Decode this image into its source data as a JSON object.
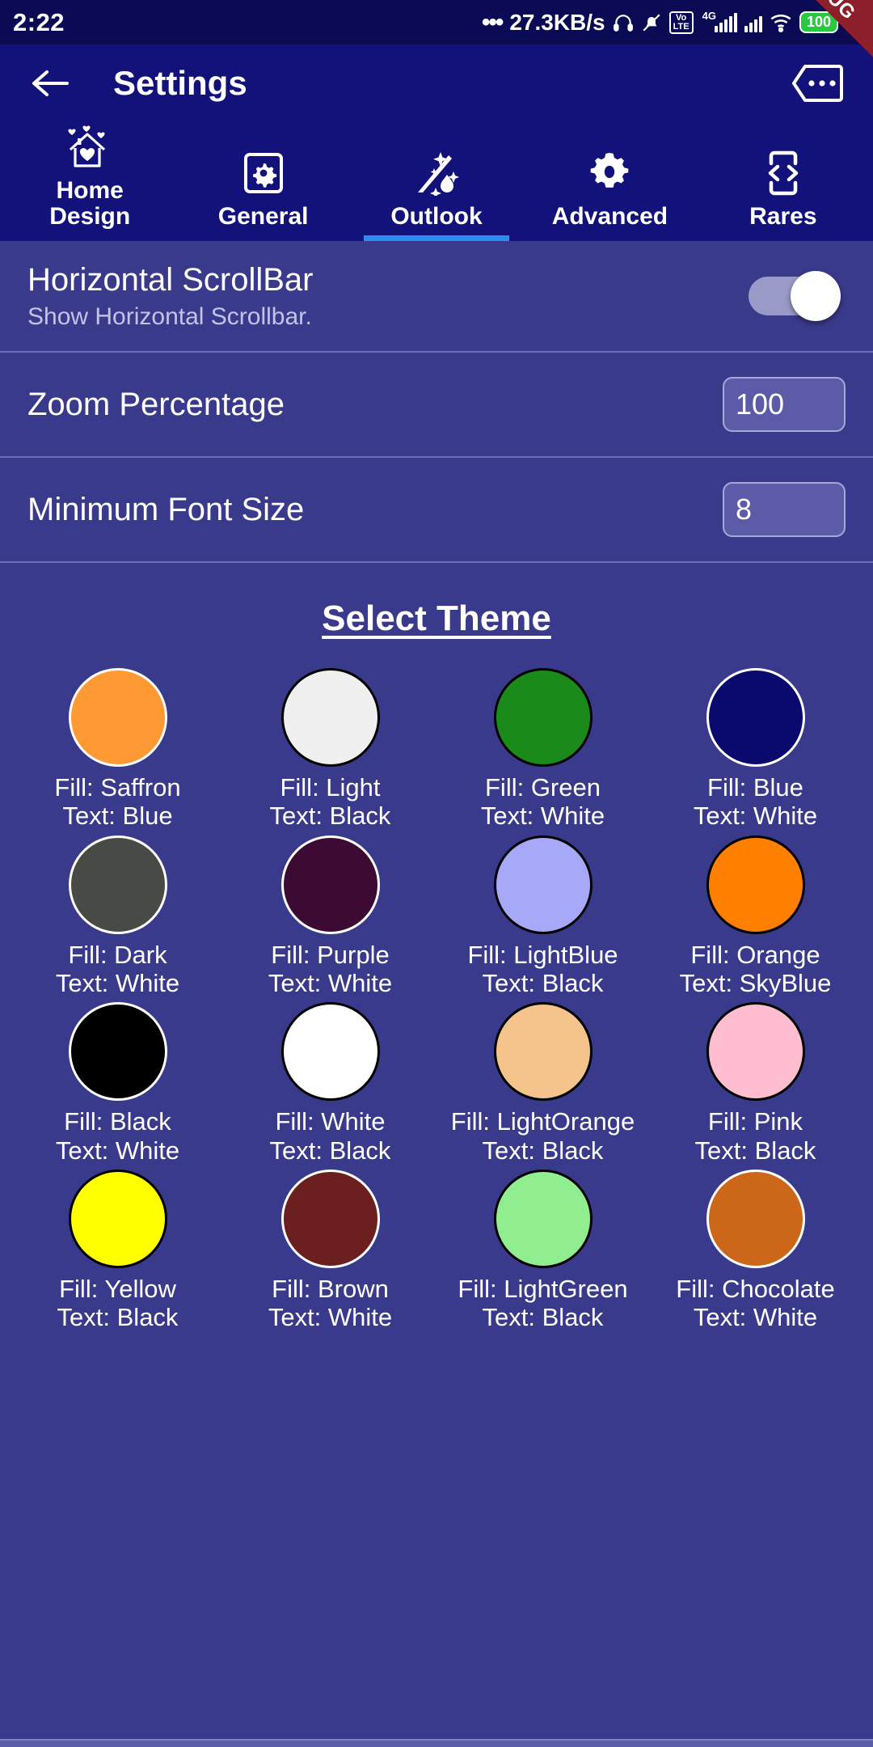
{
  "status_bar": {
    "time": "2:22",
    "dots": "•••",
    "network_speed": "27.3KB/s",
    "volte_top": "Vo",
    "volte_bottom": "LTE",
    "network_gen": "4G",
    "battery": "100",
    "icons": [
      "headset-icon",
      "bell-muted-icon",
      "volte-icon",
      "signal-bars-icon",
      "signal-bars-icon",
      "wifi-icon",
      "battery-icon",
      "charging-bolt-icon"
    ]
  },
  "debug_ribbon": {
    "label": "DEBUG"
  },
  "app_bar": {
    "back_icon": "back-arrow-icon",
    "title": "Settings",
    "overflow_icon": "overflow-menu-icon"
  },
  "tabs": {
    "active_index": 2,
    "items": [
      {
        "label": "Home\nDesign",
        "icon": "house-heart-icon"
      },
      {
        "label": "General",
        "icon": "gear-in-square-icon"
      },
      {
        "label": "Outlook",
        "icon": "moon-stars-wand-icon"
      },
      {
        "label": "Advanced",
        "icon": "gear-icon"
      },
      {
        "label": "Rares",
        "icon": "phone-code-icon"
      }
    ]
  },
  "settings": {
    "rows": [
      {
        "type": "switch",
        "title": "Horizontal ScrollBar",
        "subtitle": "Show Horizontal Scrollbar.",
        "value": "on"
      },
      {
        "type": "number",
        "title": "Zoom Percentage",
        "subtitle": "",
        "value": "100"
      },
      {
        "type": "number",
        "title": "Minimum Font Size",
        "subtitle": "",
        "value": "8"
      }
    ]
  },
  "theme_section": {
    "title": "Select Theme",
    "themes": [
      {
        "fill_label": "Fill: Saffron",
        "text_label": "Text: Blue",
        "fill": "#FF9933",
        "border": "#FFFFFF"
      },
      {
        "fill_label": "Fill: Light",
        "text_label": "Text: Black",
        "fill": "#F0F0F0",
        "border": "#000000"
      },
      {
        "fill_label": "Fill: Green",
        "text_label": "Text: White",
        "fill": "#1A8A1A",
        "border": "#000000"
      },
      {
        "fill_label": "Fill: Blue",
        "text_label": "Text: White",
        "fill": "#0A0A6E",
        "border": "#FFFFFF"
      },
      {
        "fill_label": "Fill: Dark",
        "text_label": "Text: White",
        "fill": "#474A45",
        "border": "#FFFFFF"
      },
      {
        "fill_label": "Fill: Purple",
        "text_label": "Text: White",
        "fill": "#3D0A33",
        "border": "#FFFFFF"
      },
      {
        "fill_label": "Fill: LightBlue",
        "text_label": "Text: Black",
        "fill": "#A8A8F8",
        "border": "#000000"
      },
      {
        "fill_label": "Fill: Orange",
        "text_label": "Text: SkyBlue",
        "fill": "#FF8000",
        "border": "#000000"
      },
      {
        "fill_label": "Fill: Black",
        "text_label": "Text: White",
        "fill": "#000000",
        "border": "#FFFFFF"
      },
      {
        "fill_label": "Fill: White",
        "text_label": "Text: Black",
        "fill": "#FFFFFF",
        "border": "#000000"
      },
      {
        "fill_label": "Fill: LightOrange",
        "text_label": "Text: Black",
        "fill": "#F5C48C",
        "border": "#000000"
      },
      {
        "fill_label": "Fill: Pink",
        "text_label": "Text: Black",
        "fill": "#FFBDD0",
        "border": "#000000"
      },
      {
        "fill_label": "Fill: Yellow",
        "text_label": "Text: Black",
        "fill": "#FFFF00",
        "border": "#000000"
      },
      {
        "fill_label": "Fill: Brown",
        "text_label": "Text: White",
        "fill": "#6B1F1F",
        "border": "#FFFFFF"
      },
      {
        "fill_label": "Fill: LightGreen",
        "text_label": "Text: Black",
        "fill": "#90EE90",
        "border": "#000000"
      },
      {
        "fill_label": "Fill: Chocolate",
        "text_label": "Text: White",
        "fill": "#CC6619",
        "border": "#FFFFFF"
      }
    ]
  },
  "colors": {
    "status_bar_bg": "#0A0A55",
    "app_bar_bg": "#12127A",
    "content_bg": "#3A3A8C",
    "accent": "#2D8CF0",
    "debug_ribbon": "#8C1F2A"
  }
}
